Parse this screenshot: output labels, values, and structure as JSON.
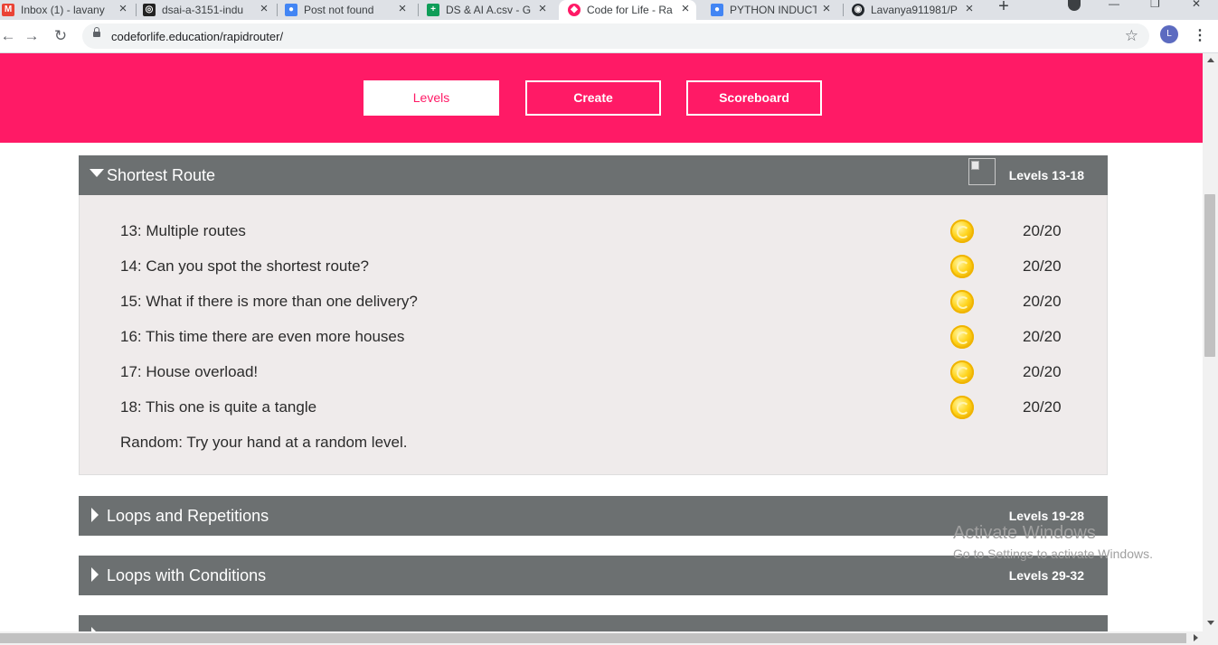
{
  "browser": {
    "tabs": [
      {
        "title": "Inbox (1) - lavany",
        "favicon": "gmail-icon",
        "favicon_color": "#ea4335",
        "favicon_glyph": "M"
      },
      {
        "title": "dsai-a-3151-indu",
        "favicon": "instagram-icon",
        "favicon_color": "#222222",
        "favicon_glyph": "◎"
      },
      {
        "title": "Post not found",
        "favicon": "person-icon",
        "favicon_color": "#4285f4",
        "favicon_glyph": "●"
      },
      {
        "title": "DS & AI A.csv - G",
        "favicon": "sheets-icon",
        "favicon_color": "#0f9d58",
        "favicon_glyph": "+"
      },
      {
        "title": "Code for Life - Ra",
        "favicon": "codeforlife-icon",
        "favicon_color": "#ff1a66",
        "favicon_glyph": "◆"
      },
      {
        "title": "PYTHON INDUCT",
        "favicon": "person-icon",
        "favicon_color": "#4285f4",
        "favicon_glyph": "●"
      },
      {
        "title": "Lavanya911981/P",
        "favicon": "github-icon",
        "favicon_color": "#24292e",
        "favicon_glyph": "◉"
      }
    ],
    "active_tab": 4,
    "url": "codeforlife.education/rapidrouter/",
    "profile_initial": "L"
  },
  "nav": {
    "levels": "Levels",
    "create": "Create",
    "scoreboard": "Scoreboard"
  },
  "episodes": [
    {
      "title": "Shortest Route",
      "range": "Levels 13-18",
      "expanded": true,
      "levels": [
        {
          "name": "13: Multiple routes",
          "score": "20/20"
        },
        {
          "name": "14: Can you spot the shortest route?",
          "score": "20/20"
        },
        {
          "name": "15: What if there is more than one delivery?",
          "score": "20/20"
        },
        {
          "name": "16: This time there are even more houses",
          "score": "20/20"
        },
        {
          "name": "17: House overload!",
          "score": "20/20"
        },
        {
          "name": "18: This one is quite a tangle",
          "score": "20/20"
        }
      ],
      "random": "Random: Try your hand at a random level."
    },
    {
      "title": "Loops and Repetitions",
      "range": "Levels 19-28",
      "expanded": false
    },
    {
      "title": "Loops with Conditions",
      "range": "Levels 29-32",
      "expanded": false
    }
  ],
  "watermark": {
    "line1": "Activate Windows",
    "line2": "Go to Settings to activate Windows."
  },
  "colors": {
    "brand": "#ff1a66",
    "episode_header": "#6c7071",
    "episode_body": "#efebeb",
    "coin": "#ffd31a"
  }
}
